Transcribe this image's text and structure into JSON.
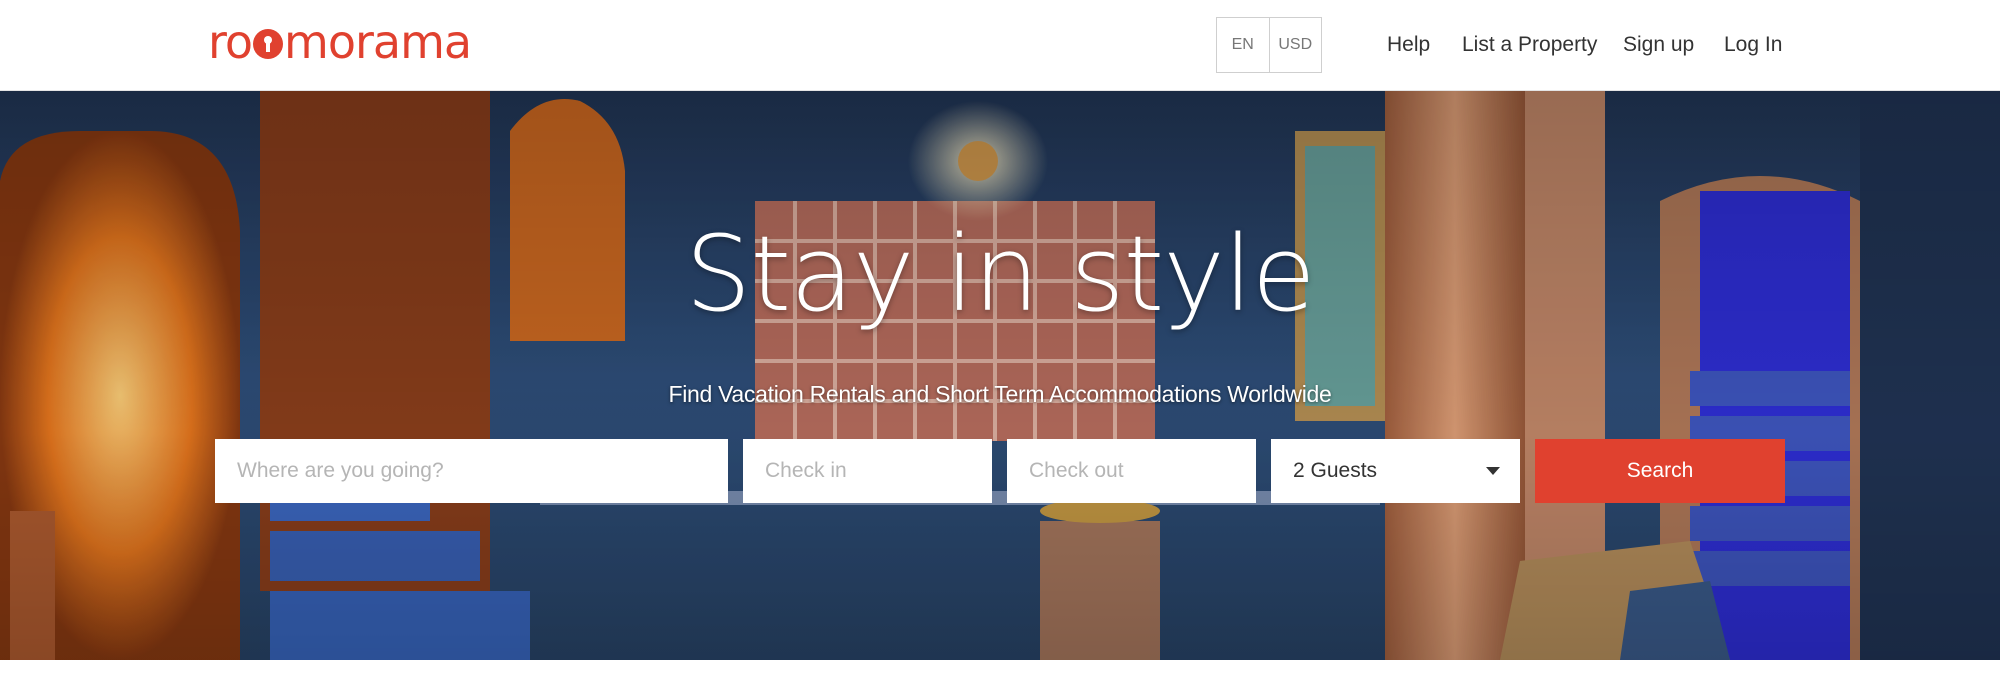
{
  "brand": {
    "logo_text_left": "ro",
    "logo_text_right": "morama",
    "color": "#e0412f"
  },
  "locale": {
    "language": "EN",
    "currency": "USD"
  },
  "nav": {
    "help": "Help",
    "list_property": "List a Property",
    "sign_up": "Sign up",
    "log_in": "Log In"
  },
  "hero": {
    "title": "Stay in style",
    "subtitle": "Find Vacation Rentals and Short Term Accommodations Worldwide"
  },
  "search": {
    "destination_placeholder": "Where are you going?",
    "checkin_placeholder": "Check in",
    "checkout_placeholder": "Check out",
    "guests_value": "2 Guests",
    "button_label": "Search"
  },
  "icons": {
    "dropdown": "caret-down-icon"
  },
  "colors": {
    "accent": "#e0412f",
    "hero_wall": "#2d4a72"
  }
}
